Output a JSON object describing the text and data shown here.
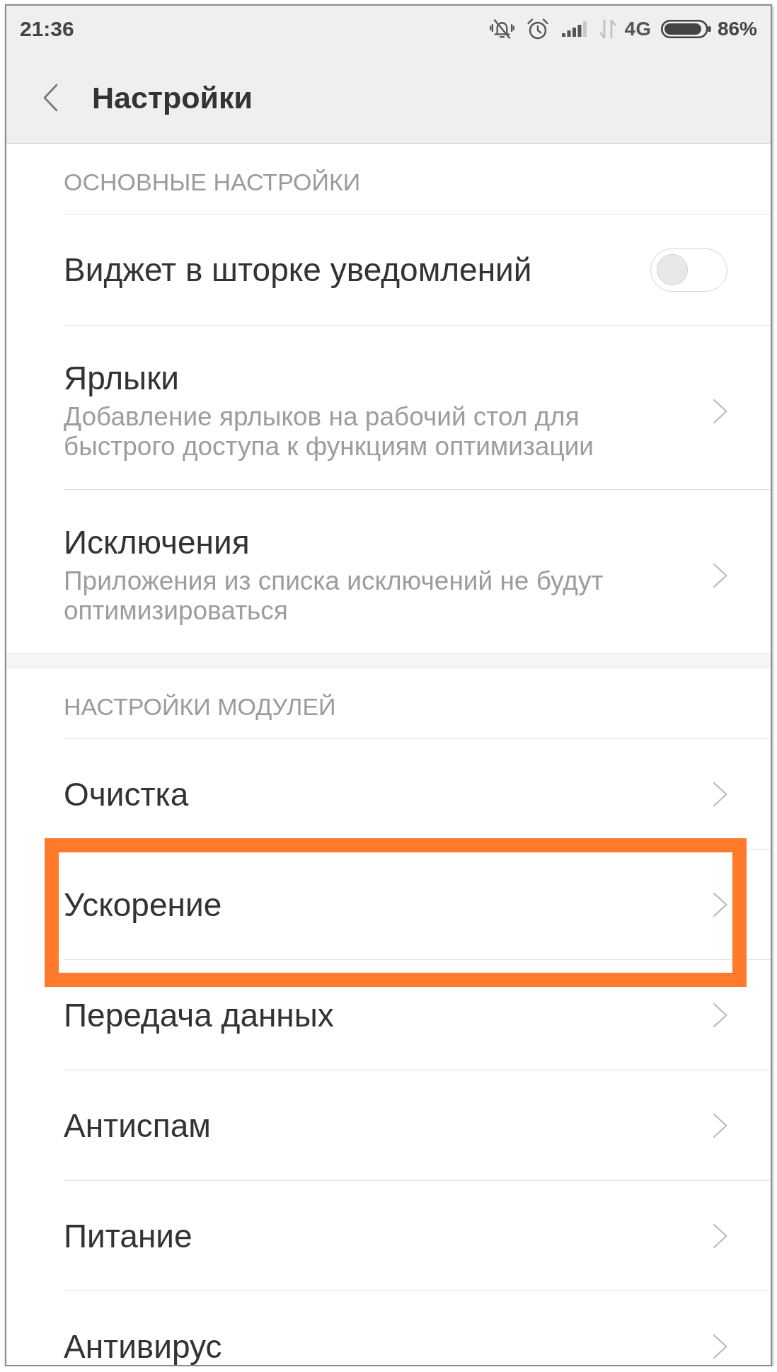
{
  "status_bar": {
    "time": "21:36",
    "network": "4G",
    "battery": "86%"
  },
  "header": {
    "title": "Настройки"
  },
  "sections": [
    {
      "title": "ОСНОВНЫЕ НАСТРОЙКИ",
      "items": [
        {
          "kind": "toggle",
          "title": "Виджет в шторке уведомлений",
          "on": false,
          "highlighted": false
        },
        {
          "kind": "link",
          "title": "Ярлыки",
          "subtitle": "Добавление ярлыков на рабочий стол для быстрого доступа к функциям оптимизации",
          "highlighted": false
        },
        {
          "kind": "link",
          "title": "Исключения",
          "subtitle": "Приложения из списка исключений не будут оптимизироваться",
          "highlighted": false
        }
      ]
    },
    {
      "title": "НАСТРОЙКИ МОДУЛЕЙ",
      "items": [
        {
          "kind": "link",
          "title": "Очистка",
          "highlighted": false
        },
        {
          "kind": "link",
          "title": "Ускорение",
          "highlighted": true
        },
        {
          "kind": "link",
          "title": "Передача данных",
          "highlighted": false
        },
        {
          "kind": "link",
          "title": "Антиспам",
          "highlighted": false
        },
        {
          "kind": "link",
          "title": "Питание",
          "highlighted": false
        },
        {
          "kind": "link",
          "title": "Антивирус",
          "highlighted": false
        }
      ]
    }
  ]
}
